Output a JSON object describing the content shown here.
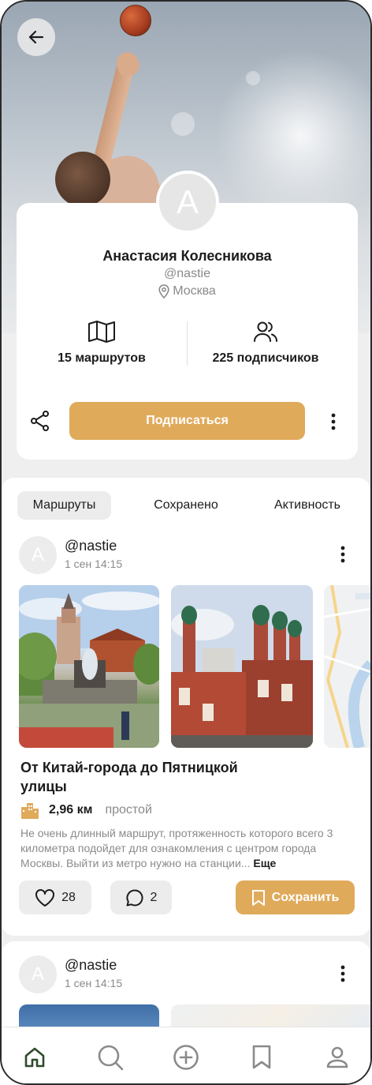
{
  "profile": {
    "avatar_letter": "A",
    "name": "Анастасия Колесникова",
    "handle": "@nastie",
    "city": "Москва",
    "routes_count": "15 маршрутов",
    "followers_count": "225 подписчиков",
    "subscribe_label": "Подписаться"
  },
  "tabs": [
    {
      "label": "Маршруты",
      "active": true
    },
    {
      "label": "Сохранено",
      "active": false
    },
    {
      "label": "Активность",
      "active": false
    }
  ],
  "posts": [
    {
      "avatar_letter": "A",
      "user": "@nastie",
      "time": "1 сен 14:15",
      "title": "От Китай-города до Пятницкой улицы",
      "distance": "2,96 км",
      "difficulty": "простой",
      "description": "Не очень длинный маршрут, протяженность которого всего 3 километра  подойдет для ознакомления с центром города Москвы. Выйти из метро нужно  на станции...",
      "more_label": "Еще",
      "likes": "28",
      "comments": "2",
      "save_label": "Сохранить"
    },
    {
      "avatar_letter": "A",
      "user": "@nastie",
      "time": "1 сен 14:15"
    }
  ],
  "nav": [
    "home-icon",
    "search-icon",
    "add-icon",
    "bookmark-icon",
    "profile-icon"
  ],
  "colors": {
    "accent": "#E0AA5B",
    "chip_bg": "#ECECEC",
    "muted_text": "#8A8A8A",
    "nav_active": "#2E4A2A"
  }
}
